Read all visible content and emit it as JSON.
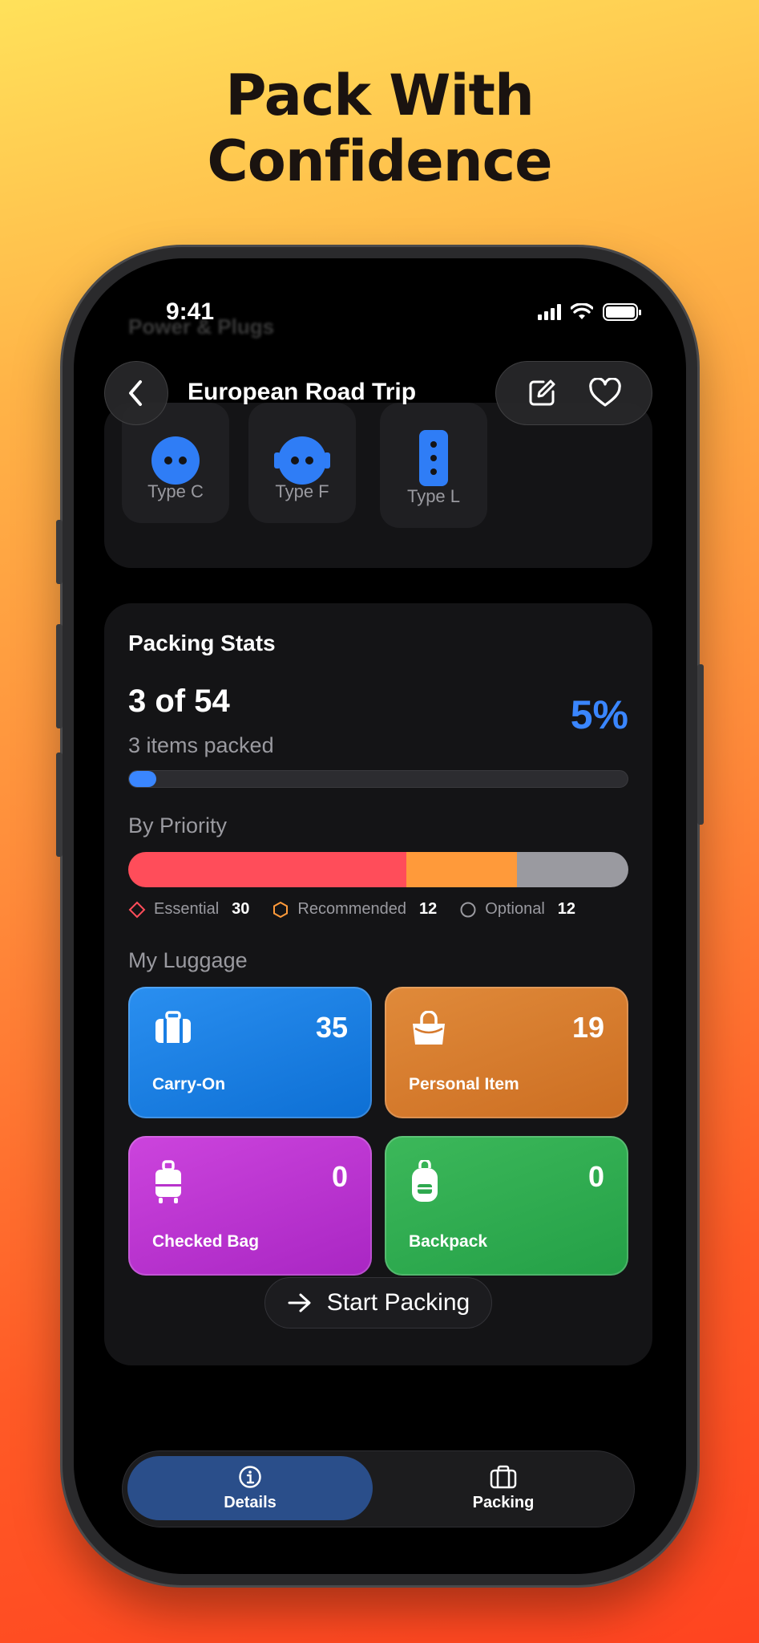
{
  "headline": {
    "line1": "Pack With",
    "line2": "Confidence"
  },
  "status_bar": {
    "time": "9:41"
  },
  "header": {
    "title": "European Road Trip",
    "ghost_section_title": "Power & Plugs"
  },
  "plugs": [
    {
      "label": "Type C"
    },
    {
      "label": "Type F"
    },
    {
      "label": "Type L"
    }
  ],
  "stats": {
    "title": "Packing Stats",
    "count_text": "3 of 54",
    "packed_text": "3 items packed",
    "percent_text": "5%",
    "progress_fraction": 0.055,
    "priority_title": "By Priority",
    "priority": [
      {
        "label": "Essential",
        "count": "30",
        "color": "#ff4d5a"
      },
      {
        "label": "Recommended",
        "count": "12",
        "color": "#ff9a3a"
      },
      {
        "label": "Optional",
        "count": "12",
        "color": "#9a9aa0"
      }
    ],
    "luggage_title": "My Luggage",
    "luggage": [
      {
        "label": "Carry-On",
        "count": "35",
        "icon": "suitcase-icon",
        "color_from": "#2a8ff0",
        "color_to": "#0d6fd4"
      },
      {
        "label": "Personal Item",
        "count": "19",
        "icon": "handbag-icon",
        "color_from": "#e08a3a",
        "color_to": "#cc6e22"
      },
      {
        "label": "Checked Bag",
        "count": "0",
        "icon": "rolling-luggage-icon",
        "color_from": "#cc44dd",
        "color_to": "#a926c3"
      },
      {
        "label": "Backpack",
        "count": "0",
        "icon": "backpack-icon",
        "color_from": "#3cb85a",
        "color_to": "#24a047"
      }
    ],
    "start_button": "Start Packing"
  },
  "tabbar": {
    "tabs": [
      {
        "label": "Details",
        "icon": "info-icon",
        "active": true
      },
      {
        "label": "Packing",
        "icon": "briefcase-icon",
        "active": false
      }
    ]
  }
}
